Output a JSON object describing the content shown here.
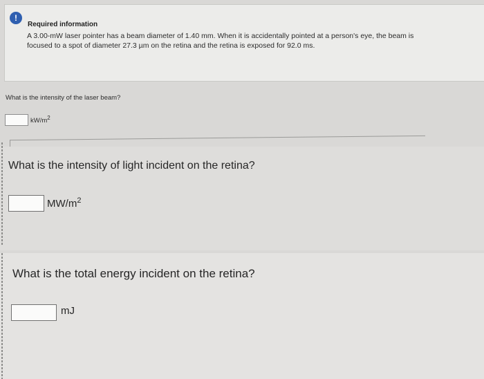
{
  "info": {
    "title": "Required information",
    "body_line1": "A 3.00-mW laser pointer has a beam diameter of 1.40 mm. When it is accidentally pointed at a person's eye, the beam is",
    "body_line2": "focused to a spot of diameter 27.3 µm on the retina and the retina is exposed for 92.0 ms.",
    "icon": "exclamation-icon",
    "icon_symbol": "!"
  },
  "q1": {
    "text": "What is the intensity of the laser beam?",
    "value": "",
    "unit": "kW/m",
    "unit_exp": "2"
  },
  "q2": {
    "text": "What is the intensity of light incident on the retina?",
    "value": "",
    "unit": "MW/m",
    "unit_exp": "2"
  },
  "q3": {
    "text": "What is the total energy incident on the retina?",
    "value": "",
    "unit": "mJ"
  },
  "colors": {
    "accent": "#2f5fb0",
    "background": "#d9d8d6",
    "card": "#ececea"
  }
}
